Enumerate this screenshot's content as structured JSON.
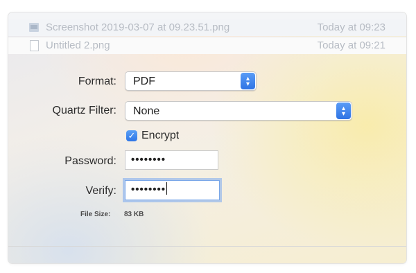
{
  "files": [
    {
      "name": "Screenshot 2019-03-07 at 09.23.51.png",
      "date": "Today at 09:23",
      "icon": "image-file-icon"
    },
    {
      "name": "Untitled 2.png",
      "date": "Today at 09:21",
      "icon": "document-file-icon"
    }
  ],
  "format": {
    "label": "Format:",
    "value": "PDF"
  },
  "quartz_filter": {
    "label": "Quartz Filter:",
    "value": "None"
  },
  "encrypt": {
    "label": "Encrypt",
    "checked": true
  },
  "password": {
    "label": "Password:",
    "value": "••••••••"
  },
  "verify": {
    "label": "Verify:",
    "value": "••••••••"
  },
  "file_size": {
    "label": "File Size:",
    "value": "83 KB"
  },
  "colors": {
    "accent": "#3478f6",
    "focus_ring": "#7aa7e8"
  }
}
